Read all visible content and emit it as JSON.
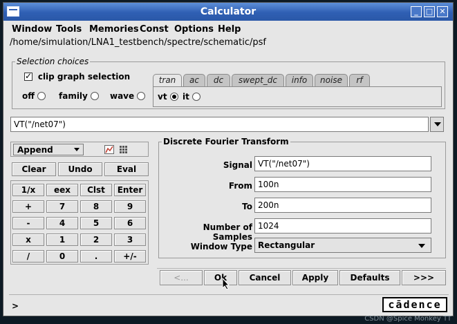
{
  "window": {
    "title": "Calculator"
  },
  "menu": [
    "Window",
    "Tools",
    "Memories",
    "Const",
    "Options",
    "Help"
  ],
  "path": "/home/simulation/LNA1_testbench/spectre/schematic/psf",
  "selection": {
    "legend": "Selection choices",
    "clip_label": "clip graph selection",
    "radios": [
      "off",
      "family",
      "wave"
    ],
    "tabs": [
      "tran",
      "ac",
      "dc",
      "swept_dc",
      "info",
      "noise",
      "rf"
    ],
    "active_tab": "tran",
    "tab_radios": [
      "vt",
      "it"
    ]
  },
  "expression": "VT(\"/net07\")",
  "keypad": {
    "mode": "Append",
    "top_row": [
      "Clear",
      "Undo",
      "Eval"
    ],
    "rows": [
      [
        "1/x",
        "eex",
        "Clst",
        "Enter"
      ],
      [
        "+",
        "7",
        "8",
        "9"
      ],
      [
        "-",
        "4",
        "5",
        "6"
      ],
      [
        "x",
        "1",
        "2",
        "3"
      ],
      [
        "/",
        "0",
        ".",
        "+/-"
      ]
    ]
  },
  "dft": {
    "legend": "Discrete Fourier Transform",
    "fields": [
      {
        "label": "Signal",
        "value": "VT(\"/net07\")"
      },
      {
        "label": "From",
        "value": "100n"
      },
      {
        "label": "To",
        "value": "200n"
      },
      {
        "label": "Number of Samples",
        "value": "1024"
      }
    ],
    "window_type_label": "Window Type",
    "window_type_value": "Rectangular"
  },
  "buttons": [
    "<...",
    "Ok",
    "Cancel",
    "Apply",
    "Defaults",
    ">>>"
  ],
  "status_text": ">",
  "logo_text": "cādence",
  "watermark": "CSDN @Spice Monkey TT"
}
